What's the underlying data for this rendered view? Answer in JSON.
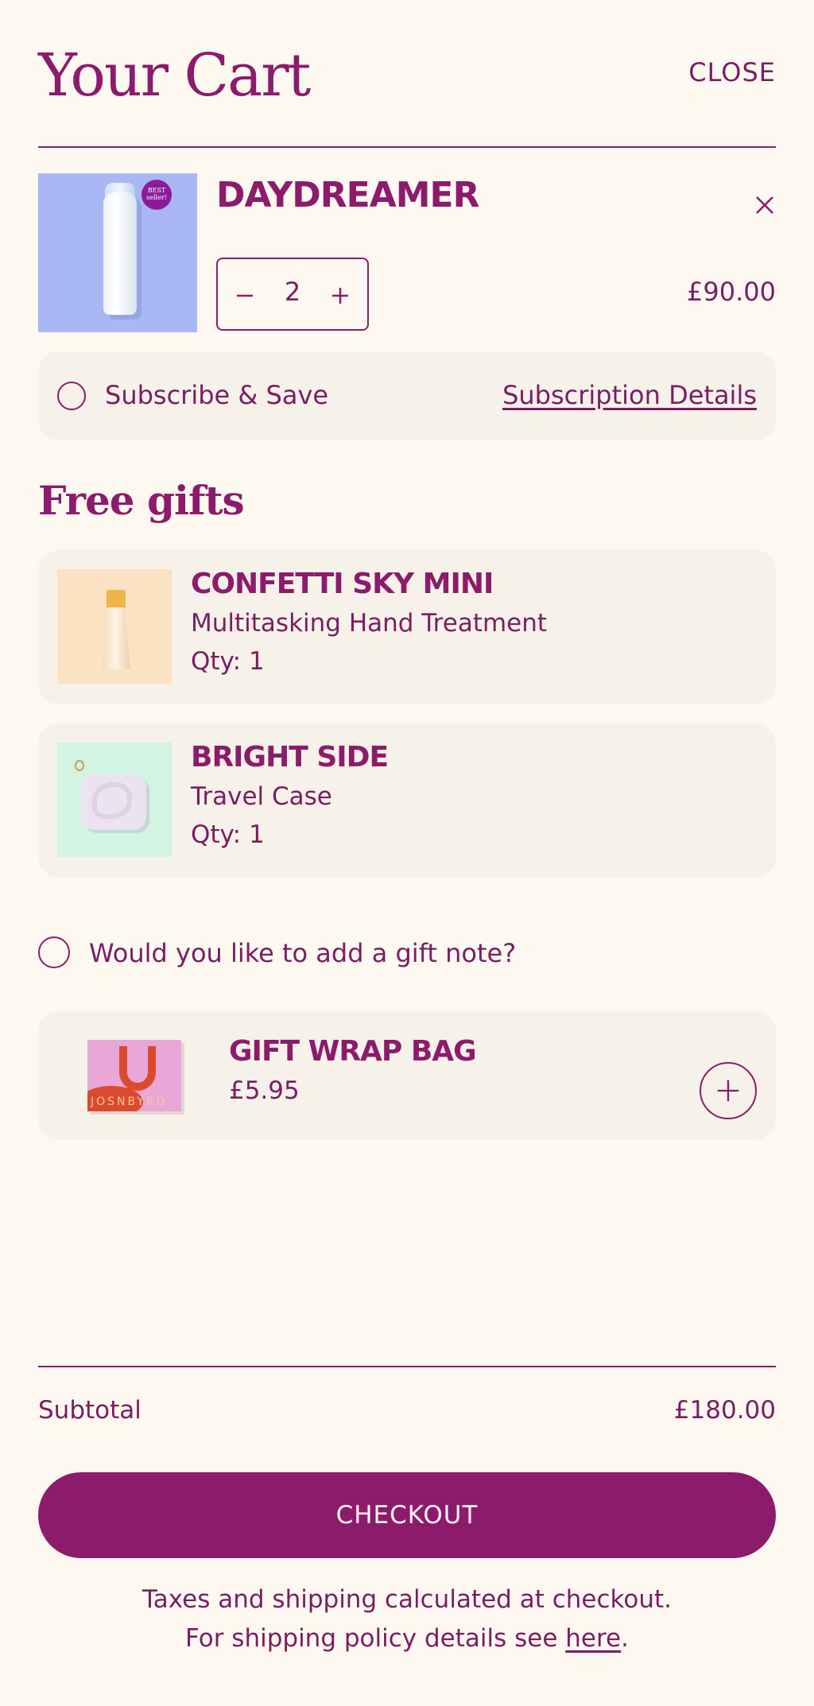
{
  "header": {
    "title": "Your Cart",
    "close_label": "CLOSE"
  },
  "item": {
    "name": "DAYDREAMER",
    "badge": "BEST seller!",
    "quantity": "2",
    "price": "£90.00"
  },
  "subscribe": {
    "label": "Subscribe & Save",
    "details_link": "Subscription Details"
  },
  "gifts": {
    "title": "Free gifts",
    "items": [
      {
        "name": "CONFETTI SKY MINI",
        "description": "Multitasking Hand Treatment",
        "qty": "Qty: 1"
      },
      {
        "name": "BRIGHT SIDE",
        "description": "Travel Case",
        "qty": "Qty: 1"
      }
    ]
  },
  "gift_note": {
    "label": "Would you like to add a gift note?"
  },
  "gift_wrap": {
    "name": "GIFT WRAP BAG",
    "price": "£5.95",
    "brand_text": "JOSNBYRD"
  },
  "footer": {
    "subtotal_label": "Subtotal",
    "subtotal_value": "£180.00",
    "checkout_label": "CHECKOUT",
    "tax_note": "Taxes and shipping calculated at checkout.",
    "shipping_prefix": "For shipping policy details see ",
    "shipping_link": "here",
    "shipping_suffix": "."
  },
  "colors": {
    "accent": "#8c1b6b",
    "background": "#fdf9f1",
    "card": "#f6f2ea"
  }
}
